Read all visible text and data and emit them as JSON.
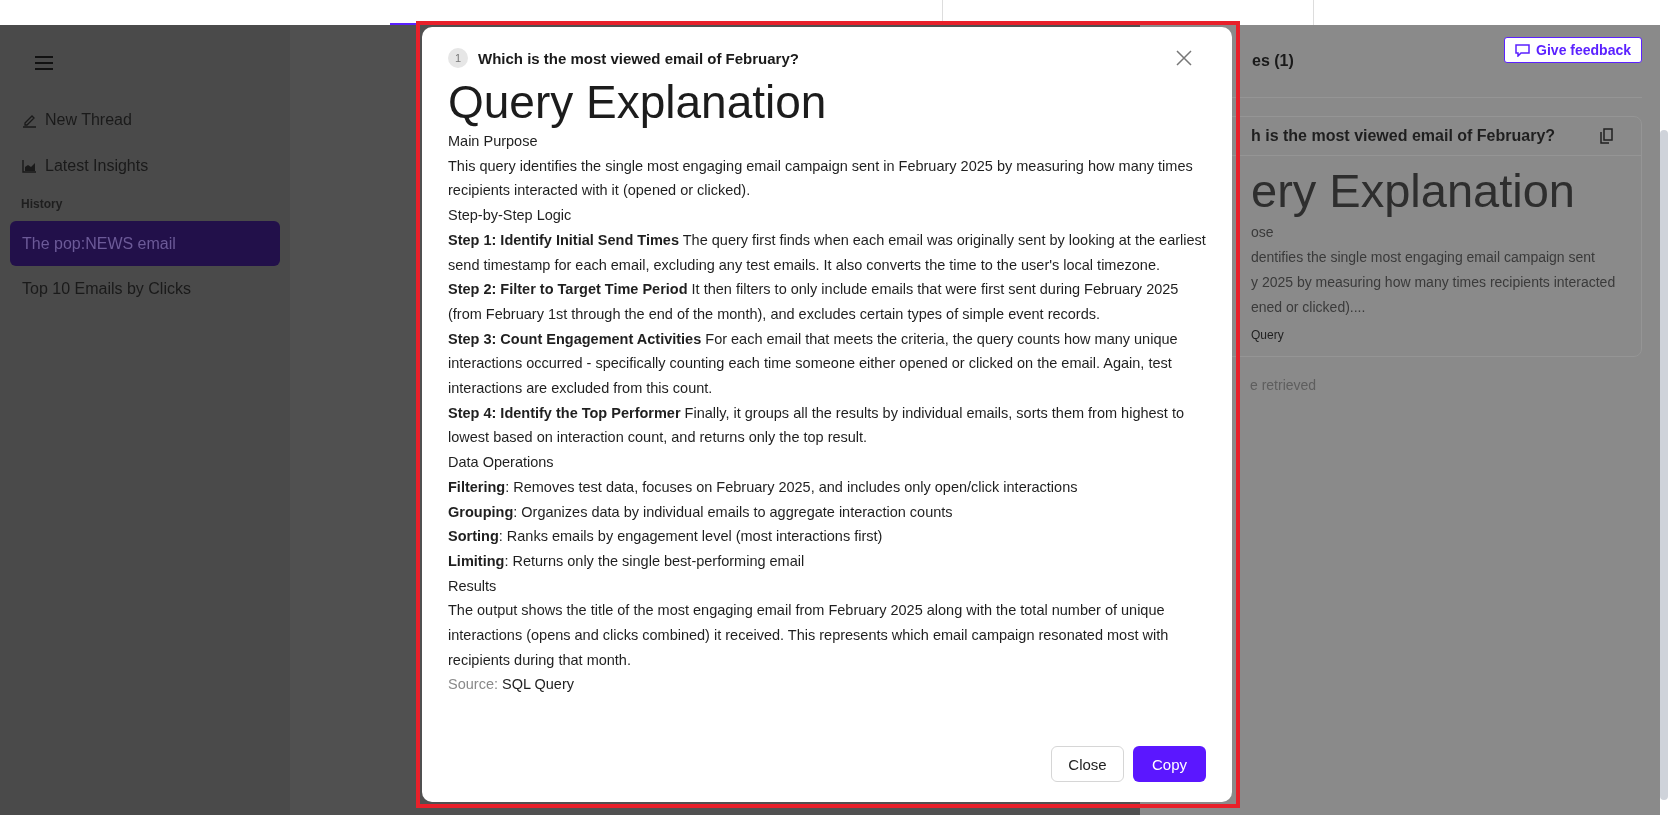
{
  "sidebar": {
    "nav": [
      {
        "label": "New Thread"
      },
      {
        "label": "Latest Insights"
      }
    ],
    "history_label": "History",
    "history": [
      {
        "label": "The pop:NEWS email",
        "selected": true
      },
      {
        "label": "Top 10 Emails by Clicks",
        "selected": false
      }
    ]
  },
  "right_panel": {
    "header": "es (1)",
    "feedback_button": "Give feedback",
    "card": {
      "question": "h is the most viewed email of February?",
      "title": "ery Explanation",
      "section": "ose",
      "lines": [
        "dentifies the single most engaging email campaign sent",
        "y 2025 by measuring how many times recipients interacted",
        "ened or clicked)...."
      ],
      "source": "Query"
    },
    "status": "e retrieved"
  },
  "modal": {
    "number": "1",
    "question": "Which is the most viewed email of February?",
    "title": "Query Explanation",
    "blocks": [
      {
        "kind": "heading",
        "text": "Main Purpose"
      },
      {
        "kind": "paragraph",
        "text": "This query identifies the single most engaging email campaign sent in February 2025 by measuring how many times recipients interacted with it (opened or clicked)."
      },
      {
        "kind": "heading",
        "text": "Step-by-Step Logic"
      },
      {
        "kind": "paragraph",
        "text": "**Step 1: Identify Initial Send Times** The query first finds when each email was originally sent by looking at the earliest send timestamp for each email, excluding any test emails. It also converts the time to the user's local timezone."
      },
      {
        "kind": "paragraph",
        "text": "**Step 2: Filter to Target Time Period** It then filters to only include emails that were first sent during February 2025 (from February 1st through the end of the month), and excludes certain types of simple event records."
      },
      {
        "kind": "paragraph",
        "text": "**Step 3: Count Engagement Activities** For each email that meets the criteria, the query counts how many unique interactions occurred - specifically counting each time someone either opened or clicked on the email. Again, test interactions are excluded from this count."
      },
      {
        "kind": "paragraph",
        "text": "**Step 4: Identify the Top Performer** Finally, it groups all the results by individual emails, sorts them from highest to lowest based on interaction count, and returns only the top result."
      },
      {
        "kind": "heading",
        "text": "Data Operations"
      },
      {
        "kind": "paragraph",
        "text": "**Filtering**: Removes test data, focuses on February 2025, and includes only open/click interactions"
      },
      {
        "kind": "paragraph",
        "text": "**Grouping**: Organizes data by individual emails to aggregate interaction counts"
      },
      {
        "kind": "paragraph",
        "text": "**Sorting**: Ranks emails by engagement level (most interactions first)"
      },
      {
        "kind": "paragraph",
        "text": "**Limiting**: Returns only the single best-performing email"
      },
      {
        "kind": "heading",
        "text": "Results"
      },
      {
        "kind": "paragraph",
        "text": "The output shows the title of the most engaging email from February 2025 along with the total number of unique interactions (opens and clicks combined) it received. This represents which email campaign resonated most with recipients during that month."
      }
    ],
    "source_label": "Source:",
    "source_value": "SQL Query",
    "buttons": [
      {
        "label": "Close",
        "kind": "secondary"
      },
      {
        "label": "Copy",
        "kind": "primary"
      }
    ]
  }
}
